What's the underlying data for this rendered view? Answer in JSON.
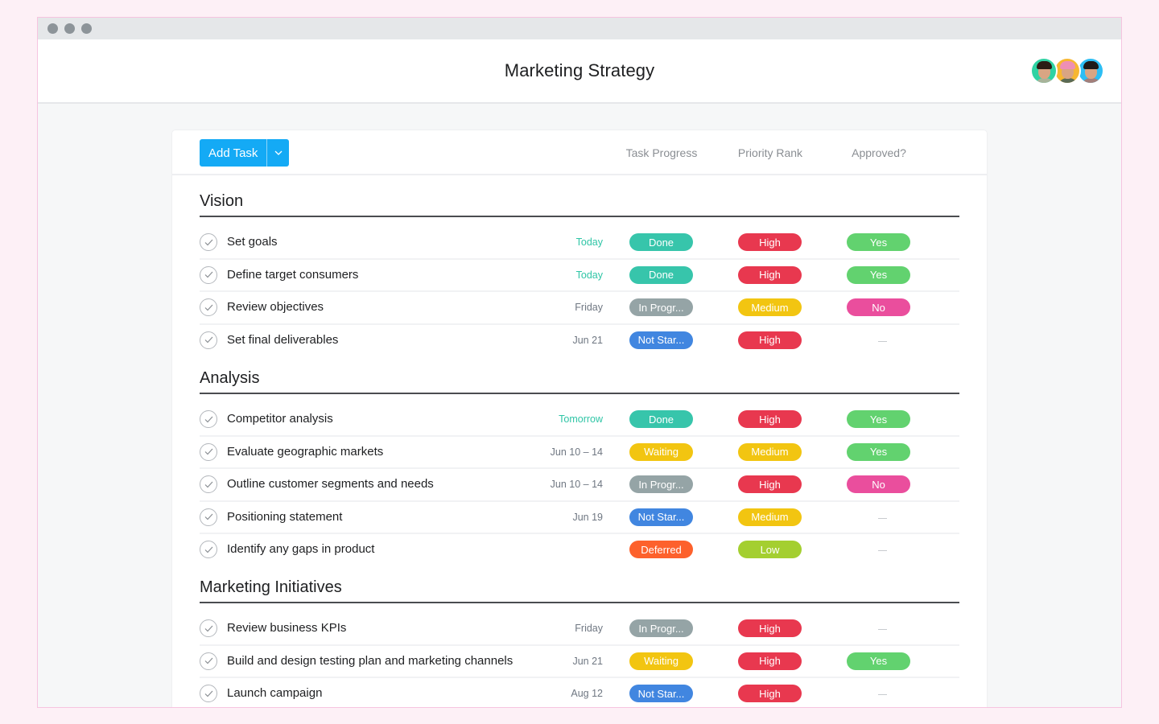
{
  "window": {
    "title": "Marketing Strategy",
    "avatars": [
      {
        "name": "team-member-1",
        "bg": "#2fd3a3",
        "hair": "#2b1d14",
        "shirt": "#a8b39a"
      },
      {
        "name": "team-member-2",
        "bg": "#f7b731",
        "hair": "#ee8fb4",
        "shirt": "#5a6a55"
      },
      {
        "name": "team-member-3",
        "bg": "#2cbef4",
        "hair": "#1f1a18",
        "shirt": "#a37f7a"
      }
    ]
  },
  "toolbar": {
    "add_task_label": "Add Task",
    "columns": [
      "Task Progress",
      "Priority Rank",
      "Approved?"
    ]
  },
  "colors": {
    "Done": "#37c5ab",
    "In Progr...": "#95a4a6",
    "Not Star...": "#4186e0",
    "Waiting": "#f2c511",
    "Deferred": "#fd612c",
    "High": "#e8384f",
    "Medium": "#f2c511",
    "Low": "#a4cf30",
    "Yes": "#62d26f",
    "No": "#ea4e9d"
  },
  "sections": [
    {
      "title": "Vision",
      "tasks": [
        {
          "name": "Set goals",
          "due": "Today",
          "due_soon": true,
          "progress": "Done",
          "priority": "High",
          "approved": "Yes"
        },
        {
          "name": "Define target consumers",
          "due": "Today",
          "due_soon": true,
          "progress": "Done",
          "priority": "High",
          "approved": "Yes"
        },
        {
          "name": "Review objectives",
          "due": "Friday",
          "due_soon": false,
          "progress": "In Progr...",
          "priority": "Medium",
          "approved": "No"
        },
        {
          "name": "Set final deliverables",
          "due": "Jun 21",
          "due_soon": false,
          "progress": "Not Star...",
          "priority": "High",
          "approved": ""
        }
      ]
    },
    {
      "title": "Analysis",
      "tasks": [
        {
          "name": "Competitor analysis",
          "due": "Tomorrow",
          "due_soon": true,
          "progress": "Done",
          "priority": "High",
          "approved": "Yes"
        },
        {
          "name": "Evaluate geographic markets",
          "due": "Jun 10 – 14",
          "due_soon": false,
          "progress": "Waiting",
          "priority": "Medium",
          "approved": "Yes"
        },
        {
          "name": "Outline customer segments and needs",
          "due": "Jun 10 – 14",
          "due_soon": false,
          "progress": "In Progr...",
          "priority": "High",
          "approved": "No"
        },
        {
          "name": "Positioning statement",
          "due": "Jun 19",
          "due_soon": false,
          "progress": "Not Star...",
          "priority": "Medium",
          "approved": ""
        },
        {
          "name": "Identify any gaps in product",
          "due": "",
          "due_soon": false,
          "progress": "Deferred",
          "priority": "Low",
          "approved": ""
        }
      ]
    },
    {
      "title": "Marketing Initiatives",
      "tasks": [
        {
          "name": "Review business KPIs",
          "due": "Friday",
          "due_soon": false,
          "progress": "In Progr...",
          "priority": "High",
          "approved": ""
        },
        {
          "name": "Build and design testing plan and marketing channels",
          "due": "Jun 21",
          "due_soon": false,
          "progress": "Waiting",
          "priority": "High",
          "approved": "Yes"
        },
        {
          "name": "Launch campaign",
          "due": "Aug 12",
          "due_soon": false,
          "progress": "Not Star...",
          "priority": "High",
          "approved": ""
        }
      ]
    }
  ]
}
